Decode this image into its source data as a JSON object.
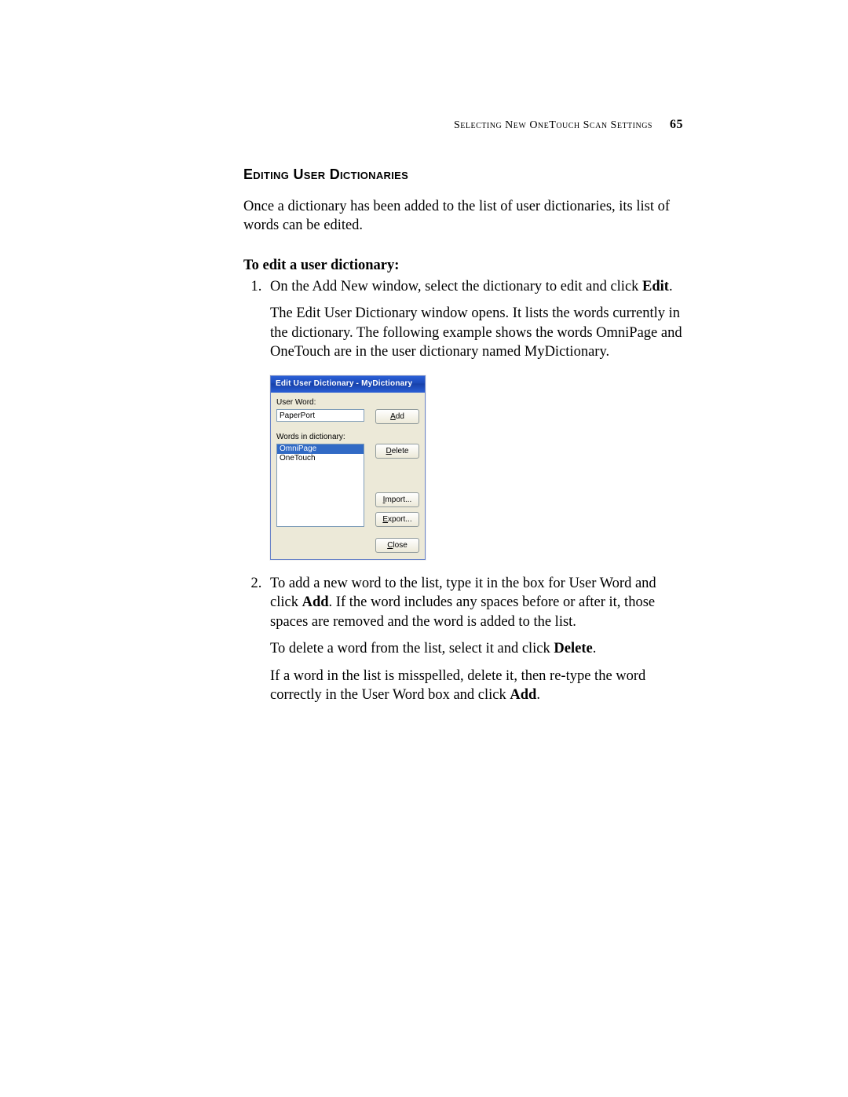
{
  "header": {
    "running_title": "Selecting New OneTouch Scan Settings",
    "page_number": "65"
  },
  "section": {
    "title": "Editing User Dictionaries",
    "intro": "Once a dictionary has been added to the list of user dictionaries, its list of words can be edited.",
    "subhead": "To edit a user dictionary:"
  },
  "steps": {
    "s1": {
      "num": "1.",
      "text_before_bold": "On the Add New window, select the dictionary to edit and click ",
      "bold1": "Edit",
      "text_after_bold": ".",
      "para2": "The Edit User Dictionary window opens. It lists the words currently in the dictionary. The following example shows the words OmniPage and OneTouch are in the user dictionary named MyDictionary."
    },
    "s2": {
      "num": "2.",
      "p1_a": "To add a new word to the list, type it in the box for User Word and click ",
      "p1_bold": "Add",
      "p1_b": ". If the word includes any spaces before or after it, those spaces are removed and the word is added to the list.",
      "p2_a": "To delete a word from the list, select it and click ",
      "p2_bold": "Delete",
      "p2_b": ".",
      "p3_a": "If a word in the list is misspelled, delete it, then re-type the word correctly in the User Word box and click ",
      "p3_bold": "Add",
      "p3_b": "."
    }
  },
  "dialog": {
    "title": "Edit User Dictionary - MyDictionary",
    "user_word_label": "User Word:",
    "user_word_value": "PaperPort",
    "words_label": "Words in dictionary:",
    "list": {
      "item0": "OmniPage",
      "item1": "OneTouch"
    },
    "buttons": {
      "add": "Add",
      "delete": "Delete",
      "import": "Import...",
      "export": "Export...",
      "close": "Close"
    },
    "underlines": {
      "add": "A",
      "delete": "D",
      "import": "I",
      "export": "E",
      "close": "C"
    }
  }
}
